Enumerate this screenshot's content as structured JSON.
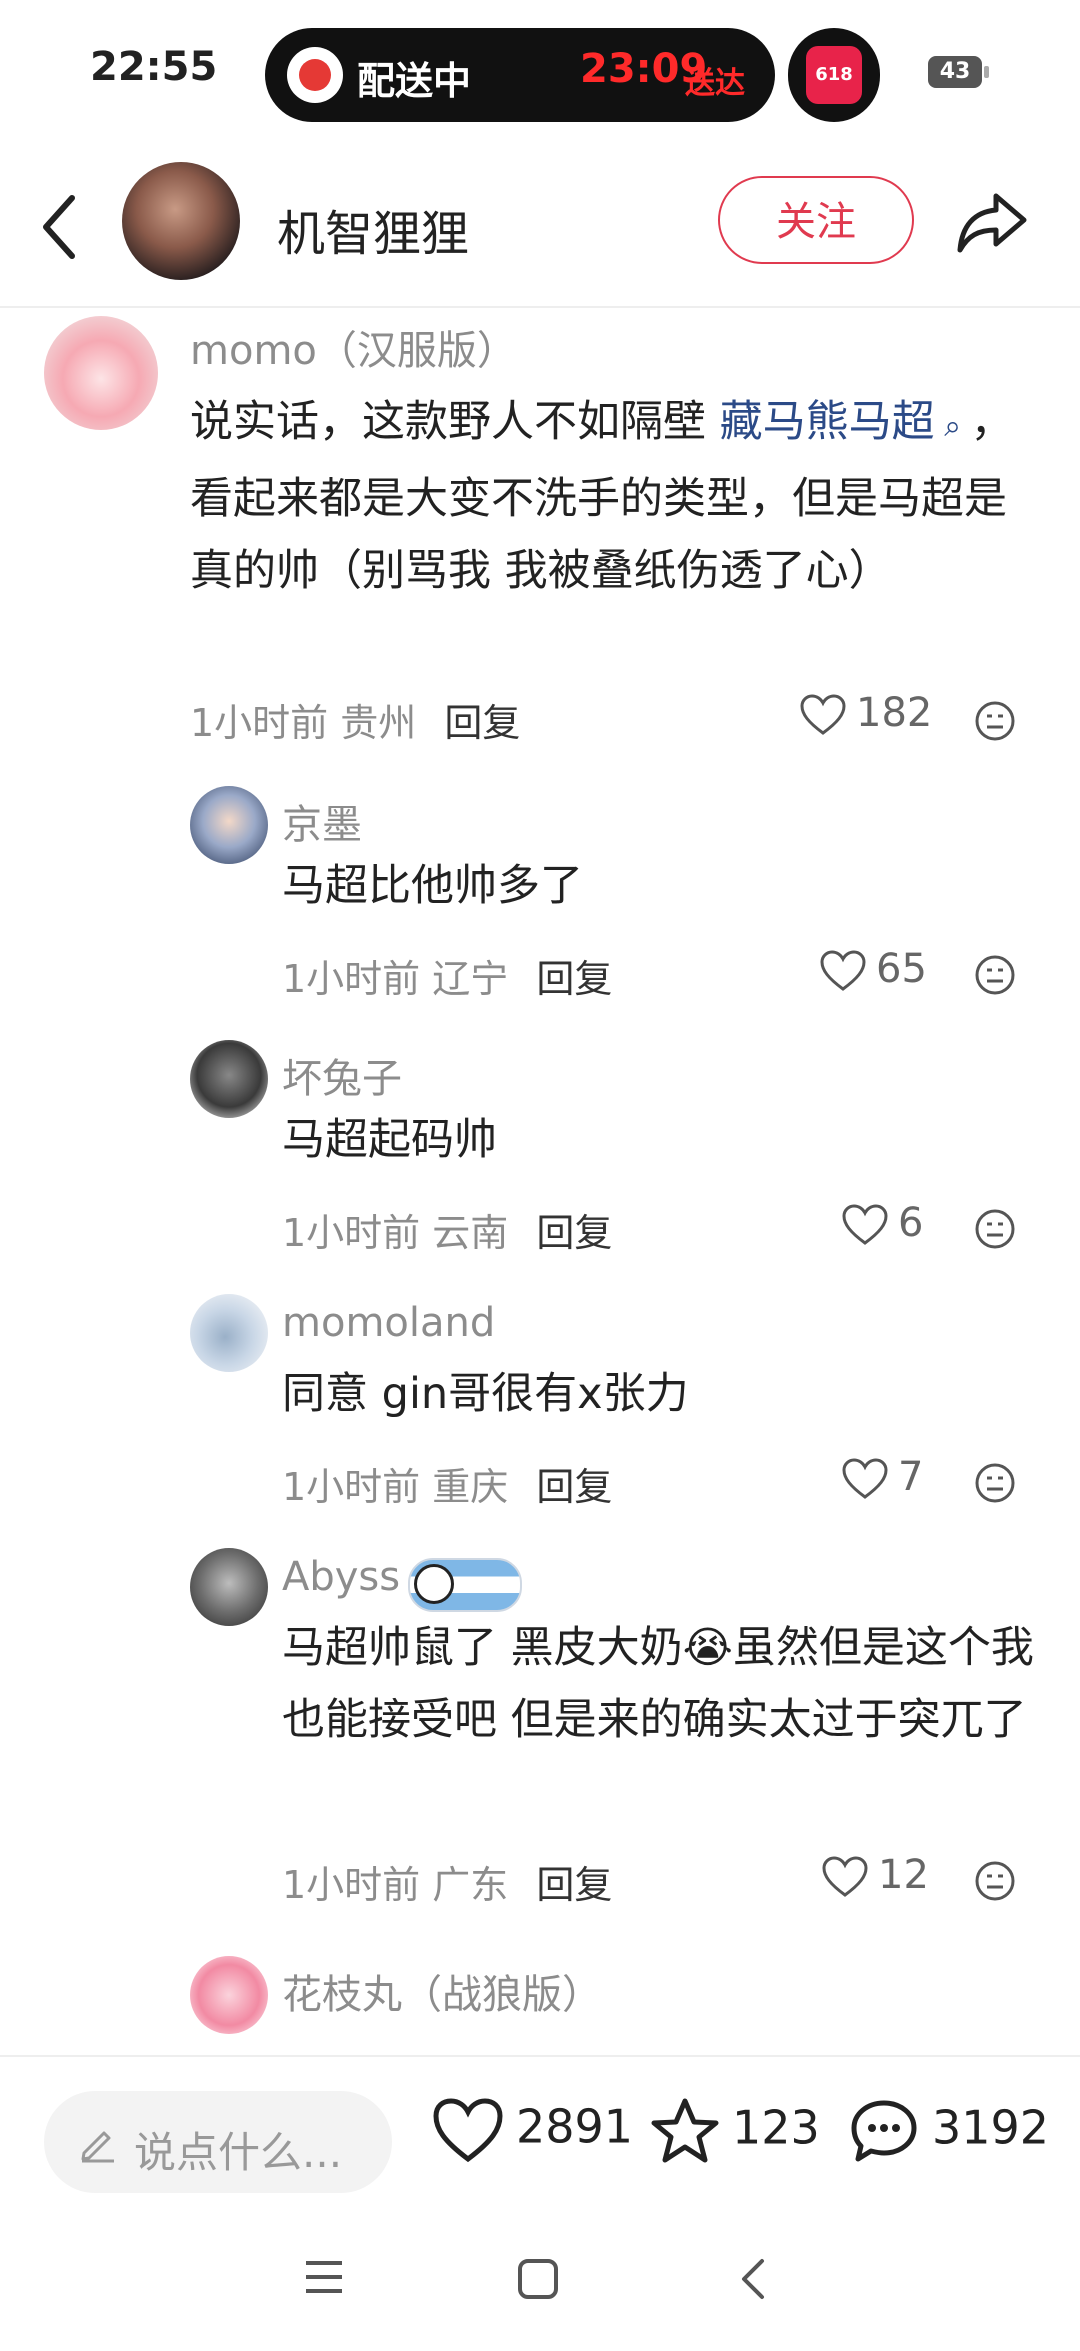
{
  "status": {
    "time": "22:55",
    "delivery_label": "配送中",
    "delivery_eta": "23:09",
    "delivery_eta_suffix": "送达",
    "app_badge": "618",
    "battery": "43"
  },
  "header": {
    "author": "机智狸狸",
    "follow_label": "关注"
  },
  "comments": [
    {
      "name": "momo（汉服版）",
      "text_parts": [
        "说实话，这款野人不如隔壁 ",
        "藏马熊马超",
        "，看起来都是大变不洗手的类型，但是马超是真的帅（别骂我 我被叠纸伤透了心）"
      ],
      "time": "1小时前",
      "location": "贵州",
      "reply_label": "回复",
      "likes": "182"
    },
    {
      "name": "京墨",
      "text": "马超比他帅多了",
      "time": "1小时前",
      "location": "辽宁",
      "reply_label": "回复",
      "likes": "65"
    },
    {
      "name": "坏兔子",
      "text": "马超起码帅",
      "time": "1小时前",
      "location": "云南",
      "reply_label": "回复",
      "likes": "6"
    },
    {
      "name": "momoland",
      "text": "同意 gin哥很有x张力",
      "time": "1小时前",
      "location": "重庆",
      "reply_label": "回复",
      "likes": "7"
    },
    {
      "name": "Abyss",
      "text": "马超帅鼠了 黑皮大奶😭虽然但是这个我也能接受吧 但是来的确实太过于突兀了",
      "time": "1小时前",
      "location": "广东",
      "reply_label": "回复",
      "likes": "12"
    },
    {
      "name": "花枝丸（战狼版）"
    }
  ],
  "bottom": {
    "input_placeholder": "说点什么...",
    "likes": "2891",
    "favorites": "123",
    "comments": "3192"
  },
  "colors": {
    "accent_red": "#e03a4f",
    "topic_blue": "#2b4a87",
    "meta_gray": "#8c8c8c"
  },
  "icons": [
    "back-icon",
    "share-icon",
    "heart-icon",
    "emoji-face-icon",
    "pencil-icon",
    "star-icon",
    "chat-bubble-icon",
    "topic-search-icon",
    "menu-icon",
    "home-square-icon",
    "nav-back-icon"
  ]
}
